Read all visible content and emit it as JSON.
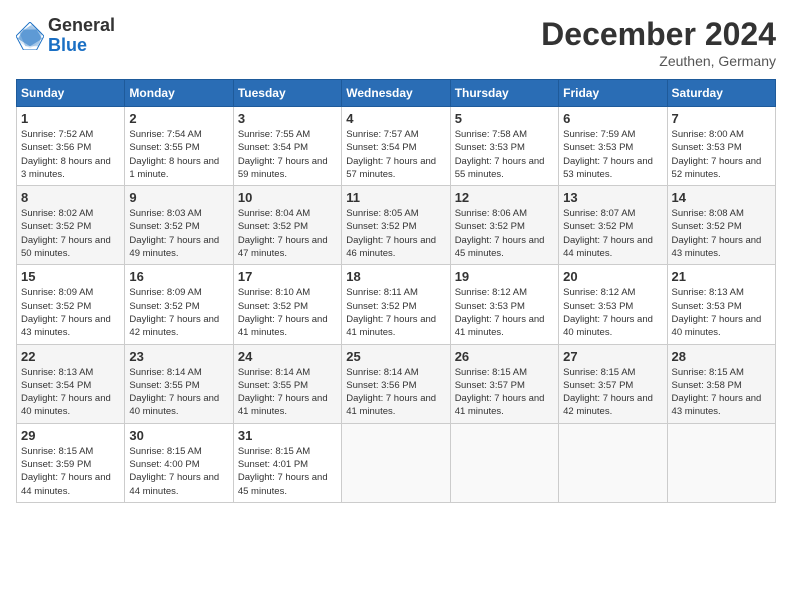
{
  "logo": {
    "general": "General",
    "blue": "Blue"
  },
  "title": "December 2024",
  "location": "Zeuthen, Germany",
  "weekdays": [
    "Sunday",
    "Monday",
    "Tuesday",
    "Wednesday",
    "Thursday",
    "Friday",
    "Saturday"
  ],
  "weeks": [
    [
      {
        "day": "1",
        "sunrise": "7:52 AM",
        "sunset": "3:56 PM",
        "daylight": "8 hours and 3 minutes."
      },
      {
        "day": "2",
        "sunrise": "7:54 AM",
        "sunset": "3:55 PM",
        "daylight": "8 hours and 1 minute."
      },
      {
        "day": "3",
        "sunrise": "7:55 AM",
        "sunset": "3:54 PM",
        "daylight": "7 hours and 59 minutes."
      },
      {
        "day": "4",
        "sunrise": "7:57 AM",
        "sunset": "3:54 PM",
        "daylight": "7 hours and 57 minutes."
      },
      {
        "day": "5",
        "sunrise": "7:58 AM",
        "sunset": "3:53 PM",
        "daylight": "7 hours and 55 minutes."
      },
      {
        "day": "6",
        "sunrise": "7:59 AM",
        "sunset": "3:53 PM",
        "daylight": "7 hours and 53 minutes."
      },
      {
        "day": "7",
        "sunrise": "8:00 AM",
        "sunset": "3:53 PM",
        "daylight": "7 hours and 52 minutes."
      }
    ],
    [
      {
        "day": "8",
        "sunrise": "8:02 AM",
        "sunset": "3:52 PM",
        "daylight": "7 hours and 50 minutes."
      },
      {
        "day": "9",
        "sunrise": "8:03 AM",
        "sunset": "3:52 PM",
        "daylight": "7 hours and 49 minutes."
      },
      {
        "day": "10",
        "sunrise": "8:04 AM",
        "sunset": "3:52 PM",
        "daylight": "7 hours and 47 minutes."
      },
      {
        "day": "11",
        "sunrise": "8:05 AM",
        "sunset": "3:52 PM",
        "daylight": "7 hours and 46 minutes."
      },
      {
        "day": "12",
        "sunrise": "8:06 AM",
        "sunset": "3:52 PM",
        "daylight": "7 hours and 45 minutes."
      },
      {
        "day": "13",
        "sunrise": "8:07 AM",
        "sunset": "3:52 PM",
        "daylight": "7 hours and 44 minutes."
      },
      {
        "day": "14",
        "sunrise": "8:08 AM",
        "sunset": "3:52 PM",
        "daylight": "7 hours and 43 minutes."
      }
    ],
    [
      {
        "day": "15",
        "sunrise": "8:09 AM",
        "sunset": "3:52 PM",
        "daylight": "7 hours and 43 minutes."
      },
      {
        "day": "16",
        "sunrise": "8:09 AM",
        "sunset": "3:52 PM",
        "daylight": "7 hours and 42 minutes."
      },
      {
        "day": "17",
        "sunrise": "8:10 AM",
        "sunset": "3:52 PM",
        "daylight": "7 hours and 41 minutes."
      },
      {
        "day": "18",
        "sunrise": "8:11 AM",
        "sunset": "3:52 PM",
        "daylight": "7 hours and 41 minutes."
      },
      {
        "day": "19",
        "sunrise": "8:12 AM",
        "sunset": "3:53 PM",
        "daylight": "7 hours and 41 minutes."
      },
      {
        "day": "20",
        "sunrise": "8:12 AM",
        "sunset": "3:53 PM",
        "daylight": "7 hours and 40 minutes."
      },
      {
        "day": "21",
        "sunrise": "8:13 AM",
        "sunset": "3:53 PM",
        "daylight": "7 hours and 40 minutes."
      }
    ],
    [
      {
        "day": "22",
        "sunrise": "8:13 AM",
        "sunset": "3:54 PM",
        "daylight": "7 hours and 40 minutes."
      },
      {
        "day": "23",
        "sunrise": "8:14 AM",
        "sunset": "3:55 PM",
        "daylight": "7 hours and 40 minutes."
      },
      {
        "day": "24",
        "sunrise": "8:14 AM",
        "sunset": "3:55 PM",
        "daylight": "7 hours and 41 minutes."
      },
      {
        "day": "25",
        "sunrise": "8:14 AM",
        "sunset": "3:56 PM",
        "daylight": "7 hours and 41 minutes."
      },
      {
        "day": "26",
        "sunrise": "8:15 AM",
        "sunset": "3:57 PM",
        "daylight": "7 hours and 41 minutes."
      },
      {
        "day": "27",
        "sunrise": "8:15 AM",
        "sunset": "3:57 PM",
        "daylight": "7 hours and 42 minutes."
      },
      {
        "day": "28",
        "sunrise": "8:15 AM",
        "sunset": "3:58 PM",
        "daylight": "7 hours and 43 minutes."
      }
    ],
    [
      {
        "day": "29",
        "sunrise": "8:15 AM",
        "sunset": "3:59 PM",
        "daylight": "7 hours and 44 minutes."
      },
      {
        "day": "30",
        "sunrise": "8:15 AM",
        "sunset": "4:00 PM",
        "daylight": "7 hours and 44 minutes."
      },
      {
        "day": "31",
        "sunrise": "8:15 AM",
        "sunset": "4:01 PM",
        "daylight": "7 hours and 45 minutes."
      },
      null,
      null,
      null,
      null
    ]
  ]
}
